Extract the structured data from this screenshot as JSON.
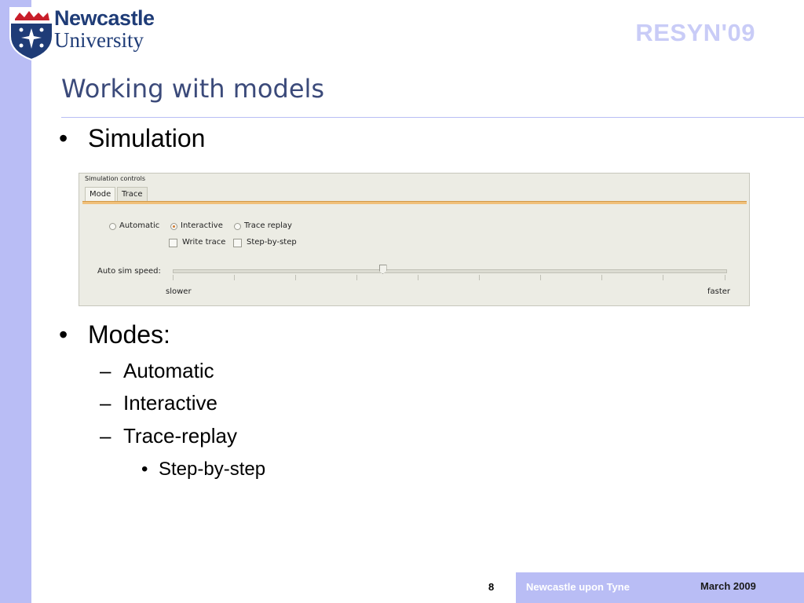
{
  "header": {
    "logo_line1": "Newcastle",
    "logo_line2": "University",
    "conference": "RESYN'09"
  },
  "slide": {
    "title": "Working with models",
    "bullet1": "Simulation",
    "bullet2": "Modes:",
    "sub_items": [
      "Automatic",
      "Interactive",
      "Trace-replay"
    ],
    "sub_sub_item": "Step-by-step"
  },
  "sim_panel": {
    "title": "Simulation controls",
    "tabs": [
      {
        "label": "Mode",
        "active": true
      },
      {
        "label": "Trace",
        "active": false
      }
    ],
    "modes": [
      {
        "label": "Automatic",
        "selected": false
      },
      {
        "label": "Interactive",
        "selected": true
      },
      {
        "label": "Trace replay",
        "selected": false
      }
    ],
    "options": [
      {
        "label": "Write trace",
        "checked": false
      },
      {
        "label": "Step-by-step",
        "checked": false
      }
    ],
    "speed_label": "Auto sim speed:",
    "speed_value": 0.38,
    "slower_label": "slower",
    "faster_label": "faster"
  },
  "footer": {
    "page_number": "8",
    "location": "Newcastle upon Tyne",
    "date": "March 2009"
  },
  "colors": {
    "accent_band": "#b9bdf5",
    "title_text": "#3b4a7a",
    "logo_text": "#1f3c77",
    "tab_rule": "#f0c07a"
  }
}
